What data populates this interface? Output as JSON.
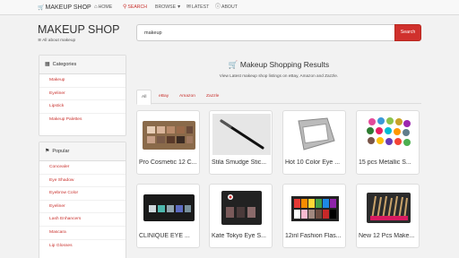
{
  "navbar": {
    "brand": "MAKEUP SHOP",
    "items": [
      {
        "label": "HOME",
        "icon": "home-icon"
      },
      {
        "label": "SEARCH",
        "icon": "search-icon"
      },
      {
        "label": "BROWSE",
        "icon": "caret-down-icon"
      },
      {
        "label": "LATEST",
        "icon": "envelope-icon"
      },
      {
        "label": "ABOUT",
        "icon": "info-icon"
      }
    ]
  },
  "header": {
    "title": "MAKEUP SHOP",
    "subtitle": "All about makeup"
  },
  "search": {
    "value": "makeup",
    "button_label": "Search"
  },
  "categories": {
    "heading": "Categories",
    "items": [
      "Makeup",
      "Eyeliner",
      "Lipstick",
      "Makeup Palettes"
    ]
  },
  "popular": {
    "heading": "Popular",
    "items": [
      "Concealer",
      "Eye Shadow",
      "Eyebrow Color",
      "Eyeliner",
      "Lash Enhancers",
      "Mascara",
      "Lip Glosses"
    ]
  },
  "results": {
    "title": "Makeup Shopping Results",
    "subtitle": "View Latest makeup shop listings on eBay, Amazon and Zazzle.",
    "tabs": [
      "All",
      "eBay",
      "Amazon",
      "Zazzle"
    ],
    "active_tab": "All",
    "products": [
      {
        "title": "Pro Cosmetic 12 C..."
      },
      {
        "title": "Stila Smudge Stic..."
      },
      {
        "title": "Hot 10 Color Eye ..."
      },
      {
        "title": "15 pcs Metallic S..."
      },
      {
        "title": "CLINIQUE EYE ..."
      },
      {
        "title": "Kate Tokyo Eye S..."
      },
      {
        "title": "12inl Fashion Flas..."
      },
      {
        "title": "New 12 Pcs Make..."
      }
    ]
  },
  "colors": {
    "accent": "#c9302c",
    "button": "#d0312d",
    "background": "#f2f2f2"
  }
}
